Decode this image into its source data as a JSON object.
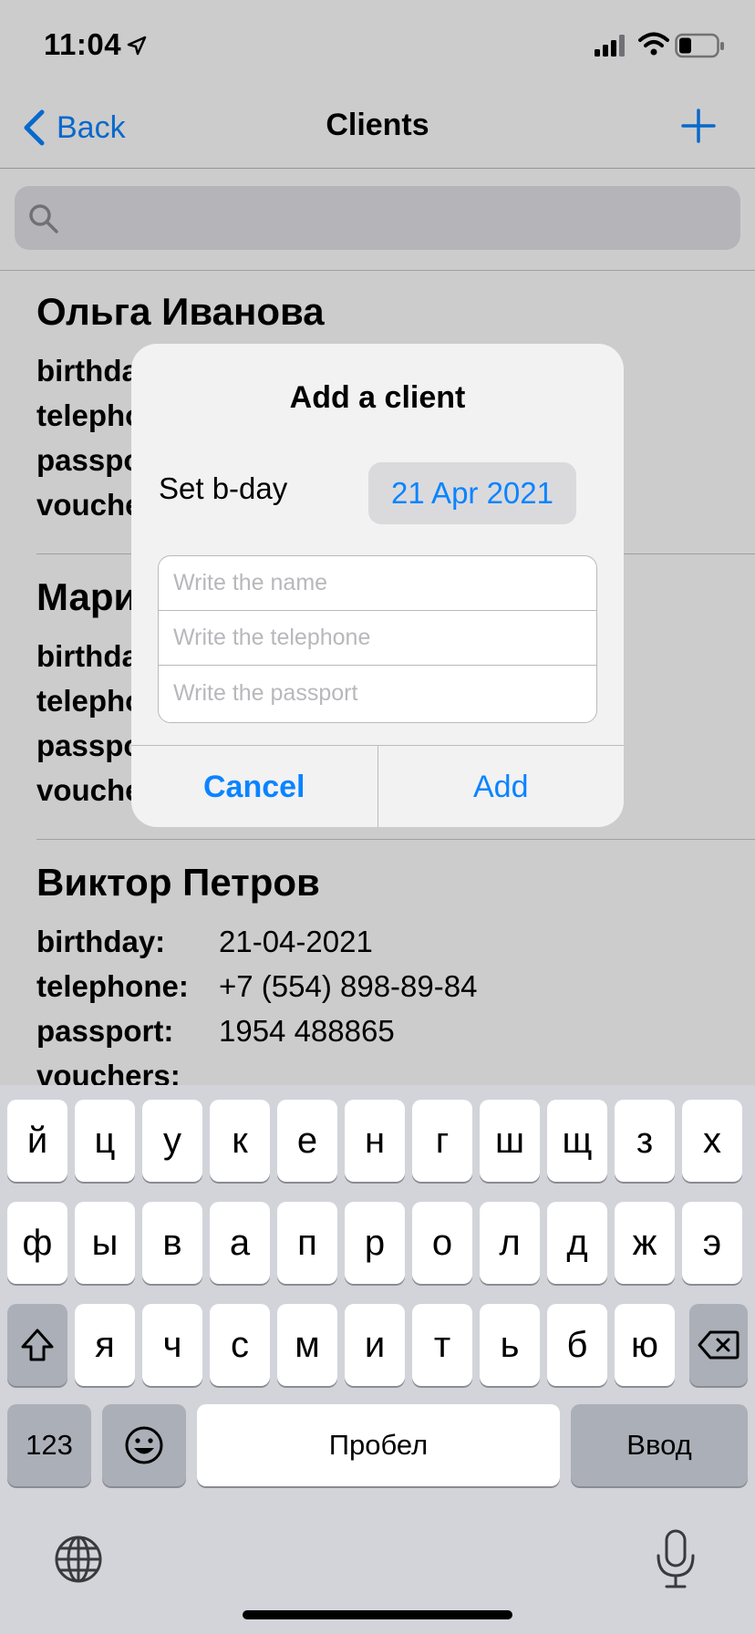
{
  "status_bar": {
    "time": "11:04"
  },
  "nav": {
    "back_label": "Back",
    "title": "Clients"
  },
  "clients": [
    {
      "name": "Ольга Иванова",
      "fields": [
        {
          "label": "birthday:",
          "value": ""
        },
        {
          "label": "telephone:",
          "value": ""
        },
        {
          "label": "passport:",
          "value": ""
        },
        {
          "label": "vouchers:",
          "value": ""
        }
      ]
    },
    {
      "name": "Мария",
      "fields": [
        {
          "label": "birthday:",
          "value": ""
        },
        {
          "label": "telephone:",
          "value": ""
        },
        {
          "label": "passport:",
          "value": ""
        },
        {
          "label": "vouchers:",
          "value": ""
        }
      ]
    },
    {
      "name": "Виктор Петров",
      "fields": [
        {
          "label": "birthday:",
          "value": "21-04-2021"
        },
        {
          "label": "telephone:",
          "value": "+7 (554) 898-89-84"
        },
        {
          "label": "passport:",
          "value": "1954 488865"
        },
        {
          "label": "vouchers:",
          "value": ""
        }
      ]
    }
  ],
  "alert": {
    "title": "Add a client",
    "bday_label": "Set b-day",
    "date_value": "21 Apr 2021",
    "name_placeholder": "Write the name",
    "telephone_placeholder": "Write the telephone",
    "passport_placeholder": "Write the passport",
    "cancel_label": "Cancel",
    "add_label": "Add"
  },
  "keyboard": {
    "row1": [
      "й",
      "ц",
      "у",
      "к",
      "е",
      "н",
      "г",
      "ш",
      "щ",
      "з",
      "х"
    ],
    "row2": [
      "ф",
      "ы",
      "в",
      "а",
      "п",
      "р",
      "о",
      "л",
      "д",
      "ж",
      "э"
    ],
    "row3": [
      "я",
      "ч",
      "с",
      "м",
      "и",
      "т",
      "ь",
      "б",
      "ю"
    ],
    "numbers_label": "123",
    "space_label": "Пробел",
    "return_label": "Ввод"
  },
  "colors": {
    "accent": "#0a84ff",
    "keyboard_bg": "#d2d4da"
  }
}
